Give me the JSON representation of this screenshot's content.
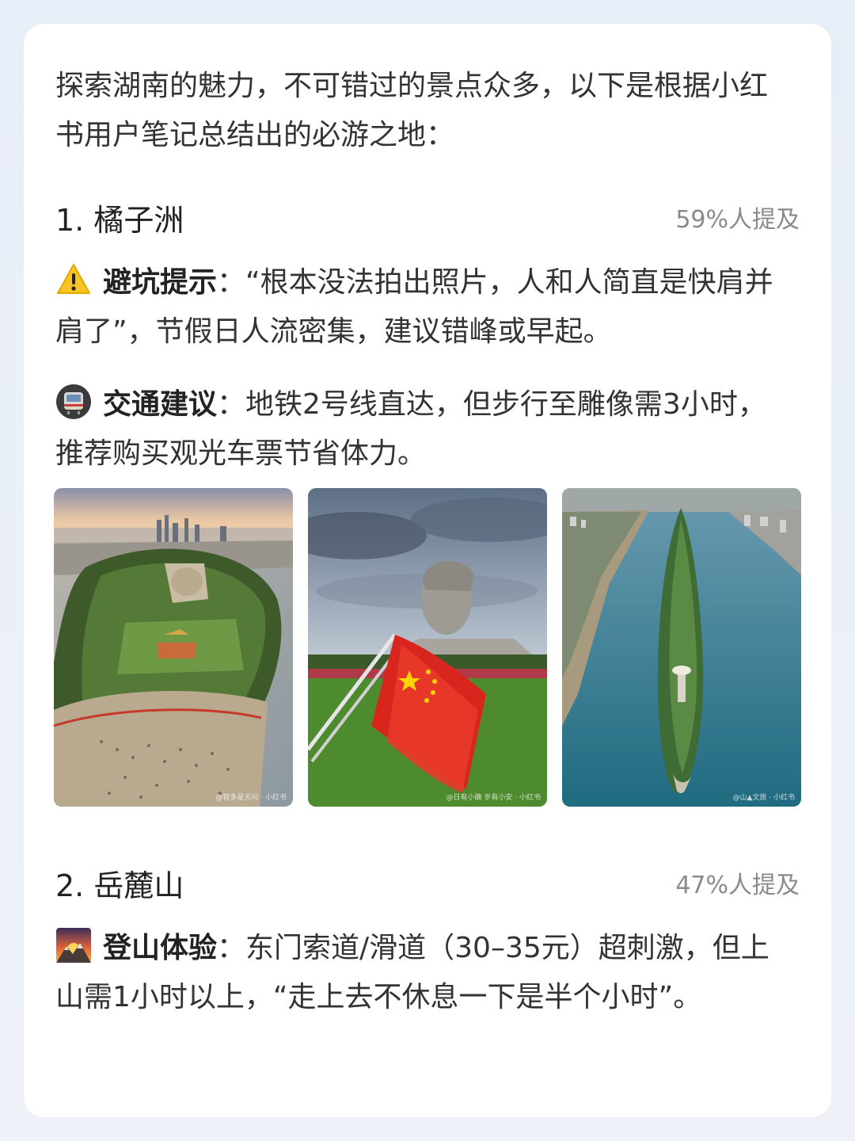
{
  "intro": "探索湖南的魅力，不可错过的景点众多，以下是根据小红书用户笔记总结出的必游之地：",
  "sections": [
    {
      "number": "1.",
      "name": "橘子洲",
      "mention": "59%人提及",
      "tips": [
        {
          "icon": "warning-icon",
          "label": "避坑提示",
          "text": "：“根本没法拍出照片，人和人简直是快肩并肩了”，节假日人流密集，建议错峰或早起。"
        },
        {
          "icon": "metro-icon",
          "label": "交通建议",
          "text": "：地铁2号线直达，但步行至雕像需3小时，推荐购买观光车票节省体力。"
        }
      ],
      "images": [
        {
          "name": "orange-isle-aerial-photo",
          "watermark": "@智多星天问 · 小红书"
        },
        {
          "name": "statue-flag-photo",
          "watermark": "@日有小确 岁有小安 · 小红书"
        },
        {
          "name": "island-river-aerial-photo",
          "watermark": "@山▲文旅 · 小红书"
        }
      ]
    },
    {
      "number": "2.",
      "name": "岳麓山",
      "mention": "47%人提及",
      "tips": [
        {
          "icon": "mountain-sunrise-icon",
          "label": "登山体验",
          "text": "：东门索道/滑道（30–35元）超刺激，但上山需1小时以上，“走上去不休息一下是半个小时”。"
        }
      ]
    }
  ],
  "colors": {
    "background": "#e8eef8",
    "card": "#ffffff",
    "text": "#333333",
    "muted": "#8a8a8a"
  }
}
